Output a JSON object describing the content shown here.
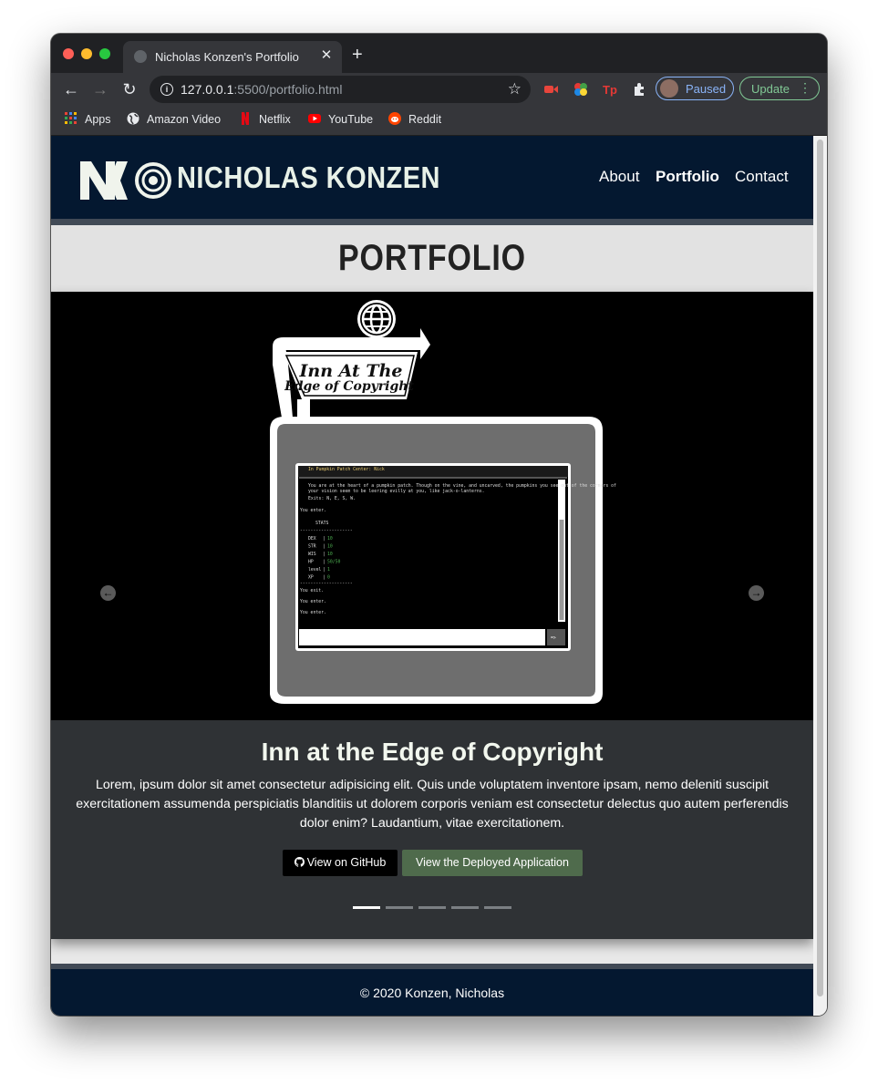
{
  "browser": {
    "tab_title": "Nicholas Konzen's Portfolio",
    "url_host": "127.0.0.1",
    "url_path": ":5500/portfolio.html",
    "profile_label": "Paused",
    "update_label": "Update",
    "bookmarks": [
      "Apps",
      "Amazon Video",
      "Netflix",
      "YouTube",
      "Reddit"
    ]
  },
  "header": {
    "brand": "NICHOLAS KONZEN",
    "nav": [
      "About",
      "Portfolio",
      "Contact"
    ]
  },
  "page_title": "PORTFOLIO",
  "slide": {
    "sign_line1": "Inn At The",
    "sign_line2": "Edge of Copyright",
    "title": "Inn at the Edge of Copyright",
    "description": "Lorem, ipsum dolor sit amet consectetur adipisicing elit. Quis unde voluptatem inventore ipsam, nemo deleniti suscipit exercitationem assumenda perspiciatis blanditiis ut dolorem corporis veniam est consectetur delectus quo autem perferendis dolor enim? Laudantium, vitae exercitationem.",
    "github_button": "View on GitHub",
    "deploy_button": "View the Deployed Application",
    "slide_count": 5,
    "active_slide": 1,
    "screen_header": "In Pumpkin Patch Center: Nick",
    "screen_desc": "You are at the heart of a pumpkin patch. Though on the vine, and uncarved, the pumpkins you see out of the corners of your vision seem to be leering evilly at you, like jack-o-lanterns.",
    "screen_exits": "Exits: N, E, S, W.",
    "screen_enter": "You enter.",
    "screen_stats": "STATS",
    "screen_rule": "--------------------",
    "stats": [
      {
        "name": "DEX",
        "value": "10"
      },
      {
        "name": "STR",
        "value": "10"
      },
      {
        "name": "WIS",
        "value": "10"
      },
      {
        "name": "HP",
        "value": "50/50"
      },
      {
        "name": "level",
        "value": "1"
      },
      {
        "name": "XP",
        "value": "0"
      }
    ],
    "screen_exit": "You exit.",
    "screen_enter2": "You enter.",
    "screen_enter3": "You enter.",
    "screen_submit": "=>"
  },
  "footer": {
    "text": "© 2020 Konzen, Nicholas"
  }
}
